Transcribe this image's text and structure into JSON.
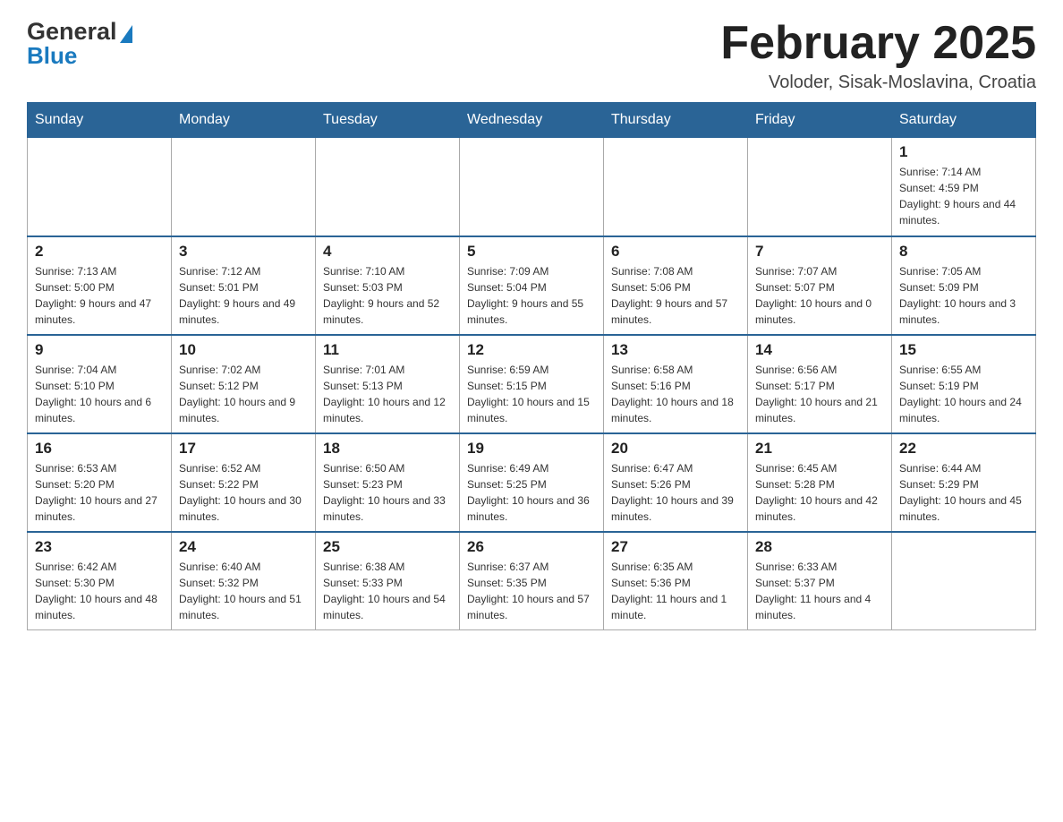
{
  "logo": {
    "general": "General",
    "blue": "Blue"
  },
  "header": {
    "title": "February 2025",
    "location": "Voloder, Sisak-Moslavina, Croatia"
  },
  "days_of_week": [
    "Sunday",
    "Monday",
    "Tuesday",
    "Wednesday",
    "Thursday",
    "Friday",
    "Saturday"
  ],
  "weeks": [
    [
      {
        "day": "",
        "sunrise": "",
        "sunset": "",
        "daylight": ""
      },
      {
        "day": "",
        "sunrise": "",
        "sunset": "",
        "daylight": ""
      },
      {
        "day": "",
        "sunrise": "",
        "sunset": "",
        "daylight": ""
      },
      {
        "day": "",
        "sunrise": "",
        "sunset": "",
        "daylight": ""
      },
      {
        "day": "",
        "sunrise": "",
        "sunset": "",
        "daylight": ""
      },
      {
        "day": "",
        "sunrise": "",
        "sunset": "",
        "daylight": ""
      },
      {
        "day": "1",
        "sunrise": "Sunrise: 7:14 AM",
        "sunset": "Sunset: 4:59 PM",
        "daylight": "Daylight: 9 hours and 44 minutes."
      }
    ],
    [
      {
        "day": "2",
        "sunrise": "Sunrise: 7:13 AM",
        "sunset": "Sunset: 5:00 PM",
        "daylight": "Daylight: 9 hours and 47 minutes."
      },
      {
        "day": "3",
        "sunrise": "Sunrise: 7:12 AM",
        "sunset": "Sunset: 5:01 PM",
        "daylight": "Daylight: 9 hours and 49 minutes."
      },
      {
        "day": "4",
        "sunrise": "Sunrise: 7:10 AM",
        "sunset": "Sunset: 5:03 PM",
        "daylight": "Daylight: 9 hours and 52 minutes."
      },
      {
        "day": "5",
        "sunrise": "Sunrise: 7:09 AM",
        "sunset": "Sunset: 5:04 PM",
        "daylight": "Daylight: 9 hours and 55 minutes."
      },
      {
        "day": "6",
        "sunrise": "Sunrise: 7:08 AM",
        "sunset": "Sunset: 5:06 PM",
        "daylight": "Daylight: 9 hours and 57 minutes."
      },
      {
        "day": "7",
        "sunrise": "Sunrise: 7:07 AM",
        "sunset": "Sunset: 5:07 PM",
        "daylight": "Daylight: 10 hours and 0 minutes."
      },
      {
        "day": "8",
        "sunrise": "Sunrise: 7:05 AM",
        "sunset": "Sunset: 5:09 PM",
        "daylight": "Daylight: 10 hours and 3 minutes."
      }
    ],
    [
      {
        "day": "9",
        "sunrise": "Sunrise: 7:04 AM",
        "sunset": "Sunset: 5:10 PM",
        "daylight": "Daylight: 10 hours and 6 minutes."
      },
      {
        "day": "10",
        "sunrise": "Sunrise: 7:02 AM",
        "sunset": "Sunset: 5:12 PM",
        "daylight": "Daylight: 10 hours and 9 minutes."
      },
      {
        "day": "11",
        "sunrise": "Sunrise: 7:01 AM",
        "sunset": "Sunset: 5:13 PM",
        "daylight": "Daylight: 10 hours and 12 minutes."
      },
      {
        "day": "12",
        "sunrise": "Sunrise: 6:59 AM",
        "sunset": "Sunset: 5:15 PM",
        "daylight": "Daylight: 10 hours and 15 minutes."
      },
      {
        "day": "13",
        "sunrise": "Sunrise: 6:58 AM",
        "sunset": "Sunset: 5:16 PM",
        "daylight": "Daylight: 10 hours and 18 minutes."
      },
      {
        "day": "14",
        "sunrise": "Sunrise: 6:56 AM",
        "sunset": "Sunset: 5:17 PM",
        "daylight": "Daylight: 10 hours and 21 minutes."
      },
      {
        "day": "15",
        "sunrise": "Sunrise: 6:55 AM",
        "sunset": "Sunset: 5:19 PM",
        "daylight": "Daylight: 10 hours and 24 minutes."
      }
    ],
    [
      {
        "day": "16",
        "sunrise": "Sunrise: 6:53 AM",
        "sunset": "Sunset: 5:20 PM",
        "daylight": "Daylight: 10 hours and 27 minutes."
      },
      {
        "day": "17",
        "sunrise": "Sunrise: 6:52 AM",
        "sunset": "Sunset: 5:22 PM",
        "daylight": "Daylight: 10 hours and 30 minutes."
      },
      {
        "day": "18",
        "sunrise": "Sunrise: 6:50 AM",
        "sunset": "Sunset: 5:23 PM",
        "daylight": "Daylight: 10 hours and 33 minutes."
      },
      {
        "day": "19",
        "sunrise": "Sunrise: 6:49 AM",
        "sunset": "Sunset: 5:25 PM",
        "daylight": "Daylight: 10 hours and 36 minutes."
      },
      {
        "day": "20",
        "sunrise": "Sunrise: 6:47 AM",
        "sunset": "Sunset: 5:26 PM",
        "daylight": "Daylight: 10 hours and 39 minutes."
      },
      {
        "day": "21",
        "sunrise": "Sunrise: 6:45 AM",
        "sunset": "Sunset: 5:28 PM",
        "daylight": "Daylight: 10 hours and 42 minutes."
      },
      {
        "day": "22",
        "sunrise": "Sunrise: 6:44 AM",
        "sunset": "Sunset: 5:29 PM",
        "daylight": "Daylight: 10 hours and 45 minutes."
      }
    ],
    [
      {
        "day": "23",
        "sunrise": "Sunrise: 6:42 AM",
        "sunset": "Sunset: 5:30 PM",
        "daylight": "Daylight: 10 hours and 48 minutes."
      },
      {
        "day": "24",
        "sunrise": "Sunrise: 6:40 AM",
        "sunset": "Sunset: 5:32 PM",
        "daylight": "Daylight: 10 hours and 51 minutes."
      },
      {
        "day": "25",
        "sunrise": "Sunrise: 6:38 AM",
        "sunset": "Sunset: 5:33 PM",
        "daylight": "Daylight: 10 hours and 54 minutes."
      },
      {
        "day": "26",
        "sunrise": "Sunrise: 6:37 AM",
        "sunset": "Sunset: 5:35 PM",
        "daylight": "Daylight: 10 hours and 57 minutes."
      },
      {
        "day": "27",
        "sunrise": "Sunrise: 6:35 AM",
        "sunset": "Sunset: 5:36 PM",
        "daylight": "Daylight: 11 hours and 1 minute."
      },
      {
        "day": "28",
        "sunrise": "Sunrise: 6:33 AM",
        "sunset": "Sunset: 5:37 PM",
        "daylight": "Daylight: 11 hours and 4 minutes."
      },
      {
        "day": "",
        "sunrise": "",
        "sunset": "",
        "daylight": ""
      }
    ]
  ]
}
